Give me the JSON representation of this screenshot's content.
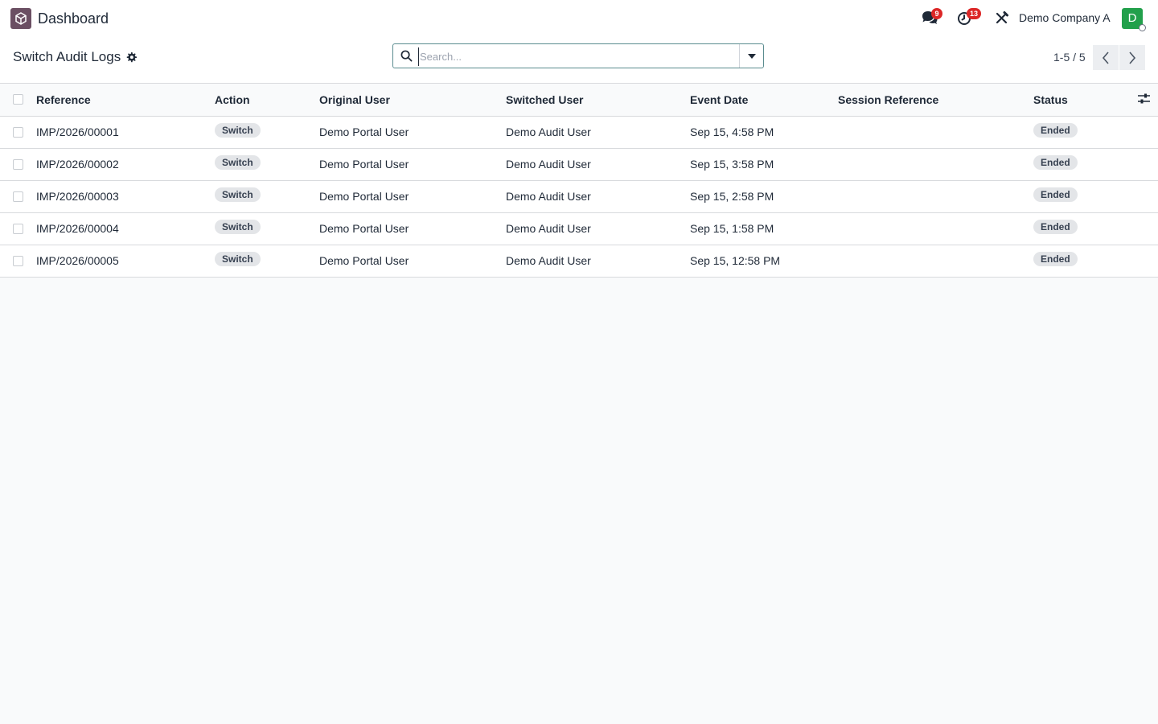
{
  "app": {
    "title": "Dashboard"
  },
  "header": {
    "messages_badge": "9",
    "activities_badge": "13",
    "company": "Demo Company A",
    "avatar_initial": "D"
  },
  "control": {
    "breadcrumb": "Switch Audit Logs",
    "search_placeholder": "Search...",
    "pager": "1-5 / 5"
  },
  "table": {
    "columns": [
      "Reference",
      "Action",
      "Original User",
      "Switched User",
      "Event Date",
      "Session Reference",
      "Status"
    ],
    "rows": [
      {
        "reference": "IMP/2026/00001",
        "action": "Switch",
        "original_user": "Demo Portal User",
        "switched_user": "Demo Audit User",
        "event_date": "Sep 15, 4:58 PM",
        "session_reference": "",
        "status": "Ended"
      },
      {
        "reference": "IMP/2026/00002",
        "action": "Switch",
        "original_user": "Demo Portal User",
        "switched_user": "Demo Audit User",
        "event_date": "Sep 15, 3:58 PM",
        "session_reference": "",
        "status": "Ended"
      },
      {
        "reference": "IMP/2026/00003",
        "action": "Switch",
        "original_user": "Demo Portal User",
        "switched_user": "Demo Audit User",
        "event_date": "Sep 15, 2:58 PM",
        "session_reference": "",
        "status": "Ended"
      },
      {
        "reference": "IMP/2026/00004",
        "action": "Switch",
        "original_user": "Demo Portal User",
        "switched_user": "Demo Audit User",
        "event_date": "Sep 15, 1:58 PM",
        "session_reference": "",
        "status": "Ended"
      },
      {
        "reference": "IMP/2026/00005",
        "action": "Switch",
        "original_user": "Demo Portal User",
        "switched_user": "Demo Audit User",
        "event_date": "Sep 15, 12:58 PM",
        "session_reference": "",
        "status": "Ended"
      }
    ]
  },
  "colors": {
    "brand": "#6b4f63",
    "avatar": "#22a04b",
    "badge": "#dc2626",
    "search_border": "#5a8c8f"
  }
}
